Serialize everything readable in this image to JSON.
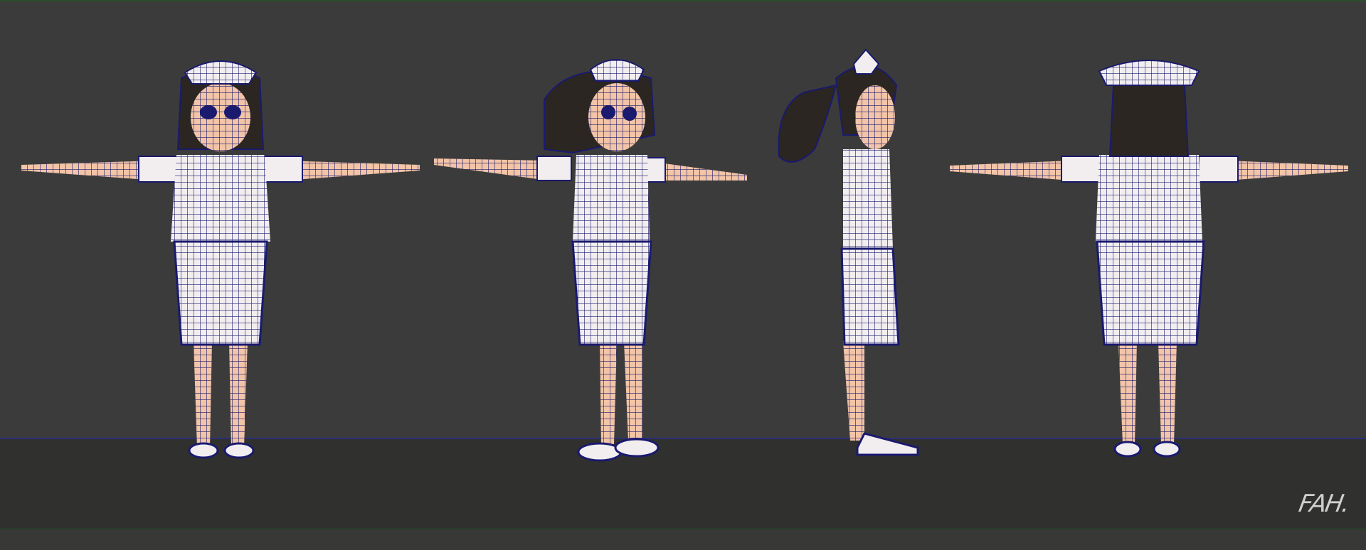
{
  "scene": {
    "views": [
      {
        "id": "front",
        "label": ""
      },
      {
        "id": "three-quarter",
        "label": ""
      },
      {
        "id": "side",
        "label": ""
      },
      {
        "id": "back",
        "label": ""
      }
    ],
    "colors": {
      "background": "#3b3b3b",
      "floor": "#30302e",
      "wireframe": "#1a1a6e",
      "uniform": "#f2eef0",
      "skin": "#f2c4a8",
      "hair": "#2b2622"
    }
  },
  "watermark": {
    "text": "FAH."
  }
}
